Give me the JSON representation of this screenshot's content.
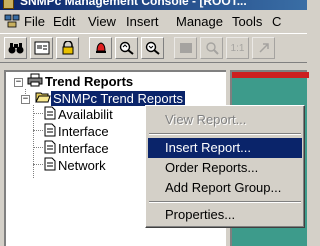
{
  "window": {
    "title": "SNMPc Management Console - [ROOT..."
  },
  "menubar": {
    "items": [
      "File",
      "Edit",
      "View",
      "Insert",
      "Manage",
      "Tools",
      "C"
    ]
  },
  "toolbar": {
    "buttons": [
      "binoculars-icon",
      "map-icon",
      "lock-icon",
      "alarm-bell-icon",
      "magnify-map-icon",
      "magnify-map-alt-icon",
      "gray-box-icon",
      "zoom-icon",
      "one-to-one-icon",
      "arrow-icon"
    ],
    "one_to_one_label": "1:1"
  },
  "tree": {
    "root": {
      "label": "Trend Reports",
      "expander": "−"
    },
    "group": {
      "label": "SNMPc Trend Reports",
      "expander": "−"
    },
    "reports": [
      "Availabilit",
      "Interface",
      "Interface",
      "Network"
    ]
  },
  "context_menu": {
    "view_report": "View Report...",
    "insert_report": "Insert Report...",
    "order_reports": "Order Reports...",
    "add_report_group": "Add Report Group...",
    "properties": "Properties..."
  }
}
